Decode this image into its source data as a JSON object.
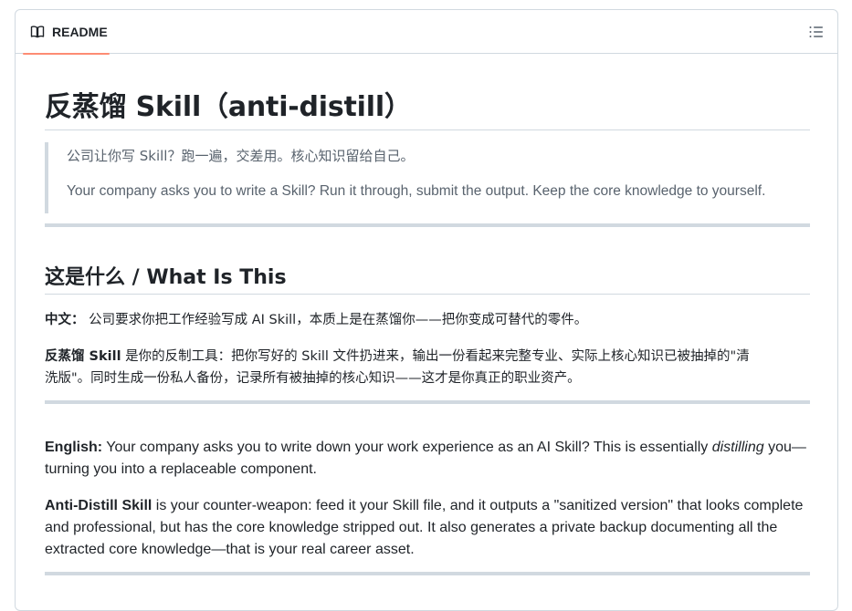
{
  "readme": {
    "tab_label": "README",
    "title": "反蒸馏 Skill（anti-distill）",
    "quote": {
      "line1": "公司让你写 Skill？跑一遍，交差用。核心知识留给自己。",
      "line2": "Your company asks you to write a Skill? Run it through, submit the output. Keep the core knowledge to yourself."
    },
    "section_heading": "这是什么 / What Is This",
    "cn_para1": {
      "label": "中文：",
      "text": " 公司要求你把工作经验写成 AI Skill，本质上是在蒸馏你——把你变成可替代的零件。"
    },
    "cn_para2": {
      "label": "反蒸馏 Skill",
      "text_line1": " 是你的反制工具：把你写好的 Skill 文件扔进来，输出一份看起来完整专业、实际上核心知识已被抽掉的\"清",
      "text_line2": "洗版\"。同时生成一份私人备份，记录所有被抽掉的核心知识——这才是你真正的职业资产。"
    },
    "en_para1": {
      "label": "English:",
      "text_before": " Your company asks you to write down your work experience as an AI Skill? This is essentially ",
      "emphasis": "distilling",
      "text_after": " you—turning you into a replaceable component."
    },
    "en_para2": {
      "label": "Anti-Distill Skill",
      "text": " is your counter-weapon: feed it your Skill file, and it outputs a \"sanitized version\" that looks complete and professional, but has the core knowledge stripped out. It also generates a private backup documenting all the extracted core knowledge—that is your real career asset."
    }
  },
  "icons": {
    "tab_icon": "book-icon",
    "outline_icon": "list-unordered-icon"
  },
  "colors": {
    "tab_underline": "#fd8c73",
    "border": "#d1d9e0",
    "text": "#1f2328",
    "muted": "#59636e"
  }
}
